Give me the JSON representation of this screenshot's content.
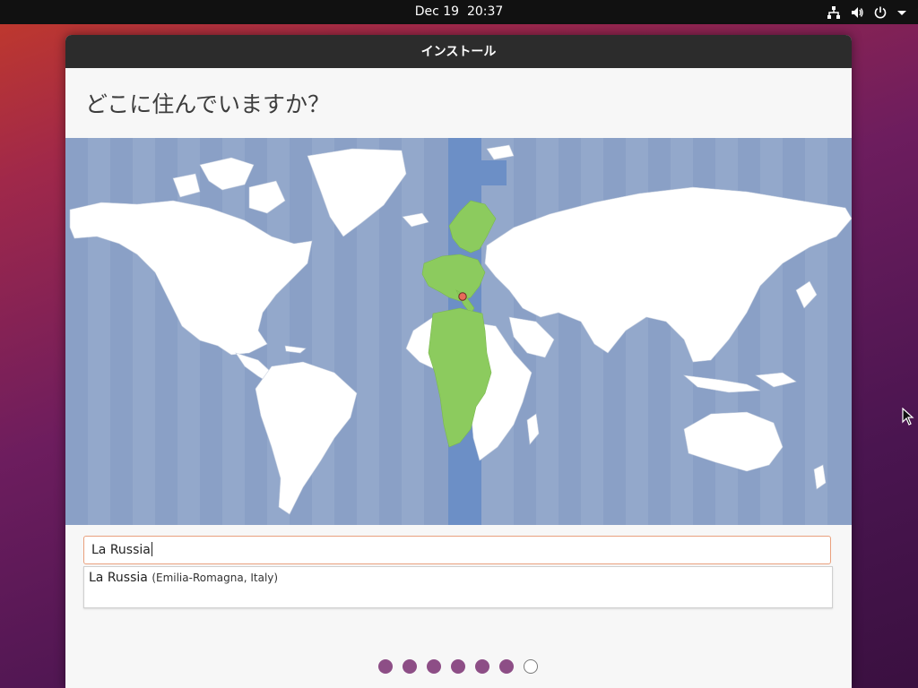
{
  "topbar": {
    "date": "Dec 19",
    "time": "20:37",
    "icons": [
      "network-icon",
      "volume-icon",
      "power-icon",
      "menu-arrow-icon"
    ]
  },
  "window": {
    "title": "インストール",
    "heading": "どこに住んでいますか？"
  },
  "map": {
    "selected_region": "Europe/Rome timezone band",
    "highlight_color": "#8ccb5e",
    "ocean_color": "#93a8cb",
    "band_color": "#6c8fc6",
    "marker_color": "#e86a5a"
  },
  "search": {
    "value": "La Russia"
  },
  "suggestions": [
    {
      "name": "La Russia",
      "detail": "(Emilia-Romagna, Italy)"
    }
  ],
  "progress": {
    "steps": 7,
    "completed": 6,
    "current": 7,
    "color": "#8d4e86"
  }
}
